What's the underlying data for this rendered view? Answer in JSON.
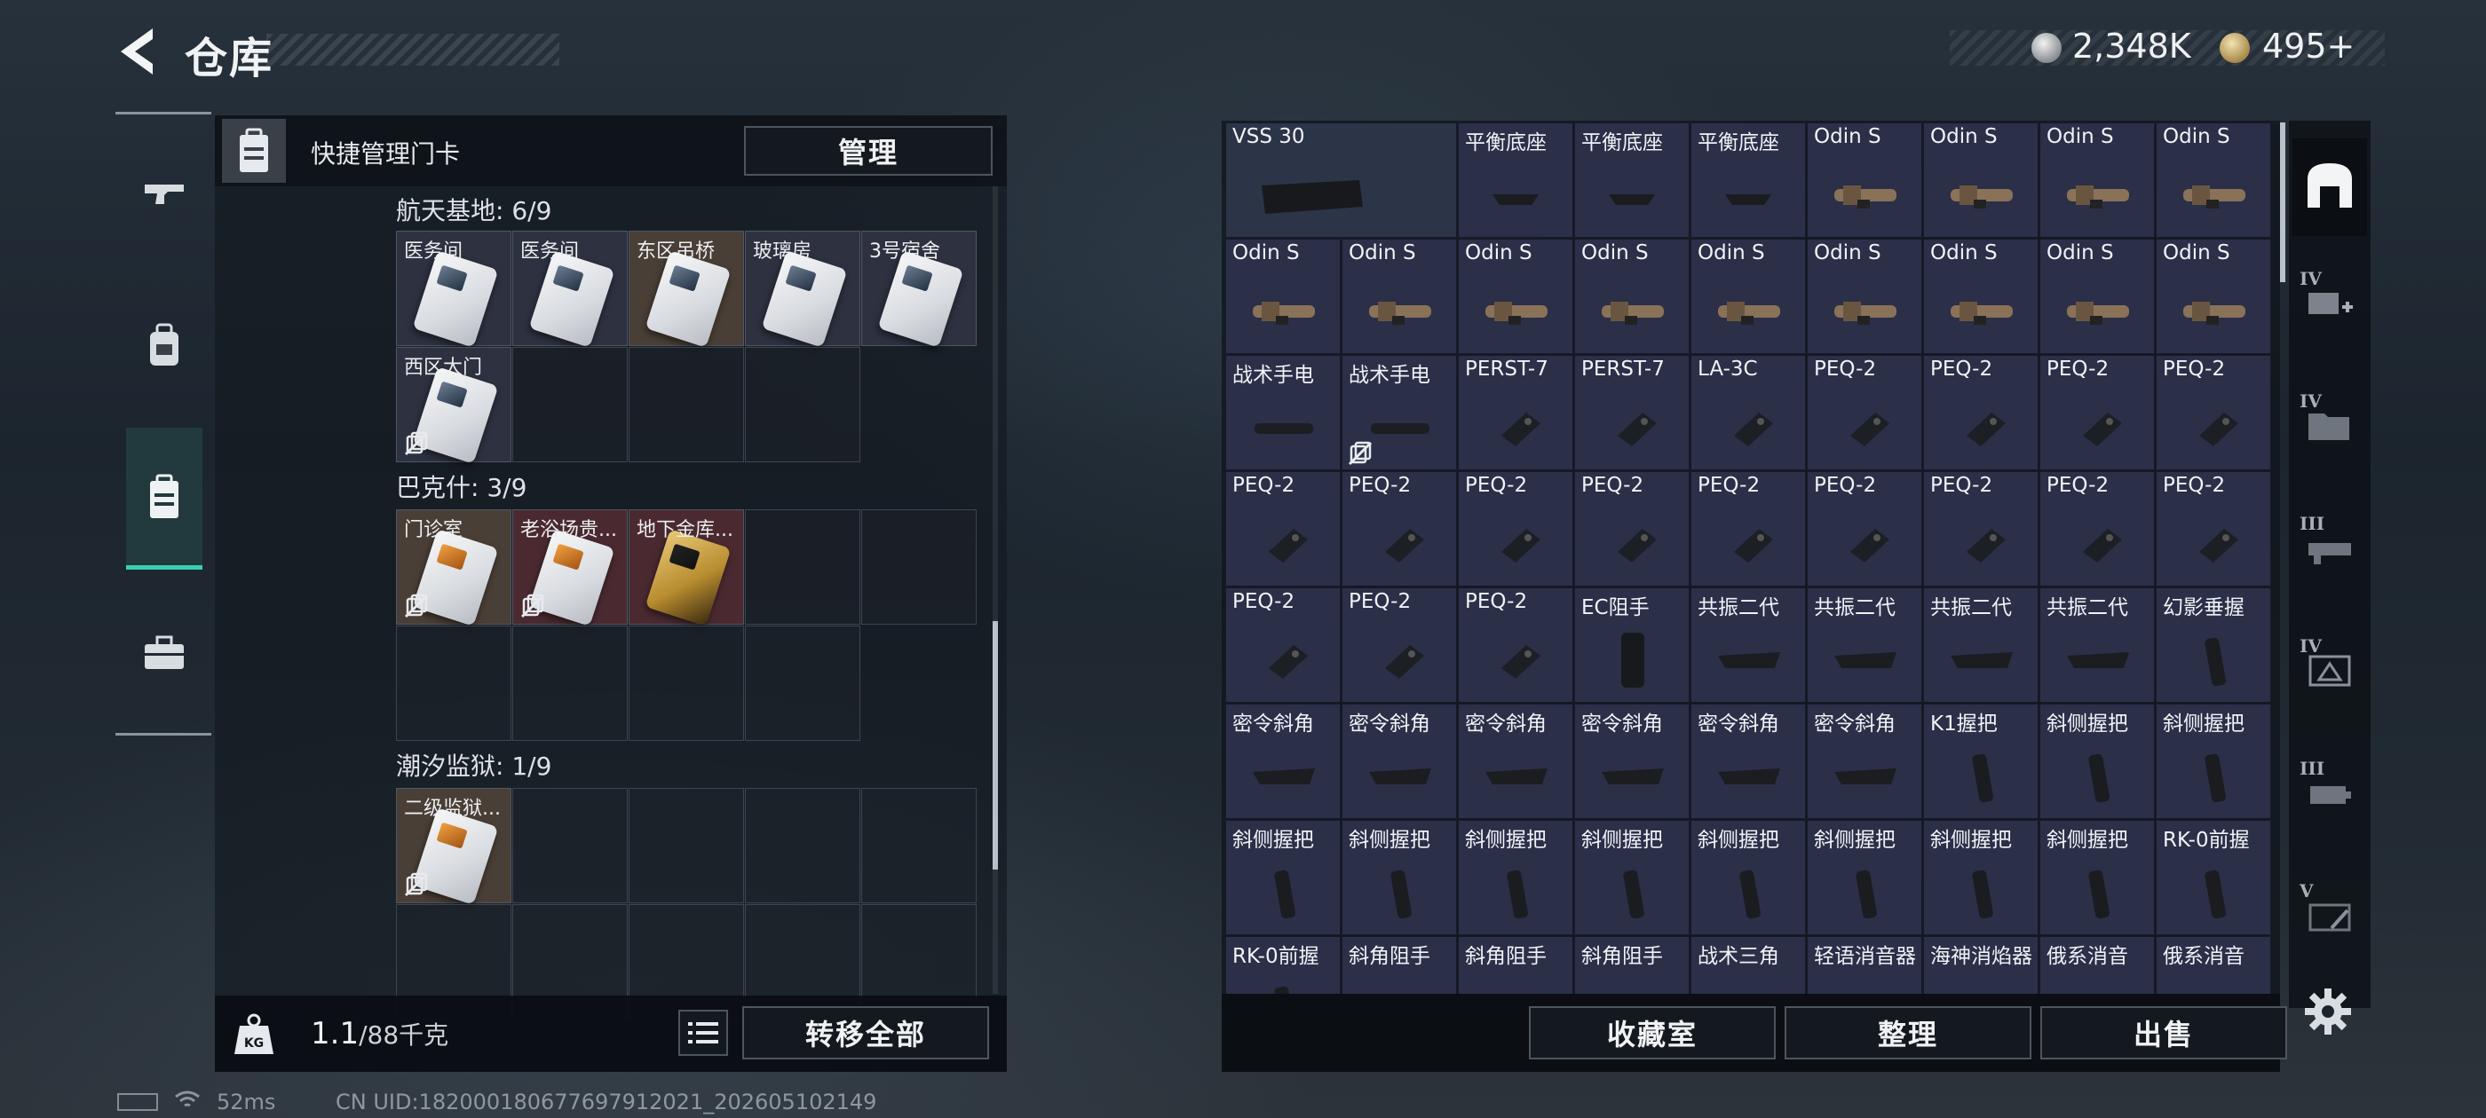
{
  "header": {
    "title": "仓库"
  },
  "currency": {
    "silver": "2,348K",
    "gold": "495+"
  },
  "left_rail": {
    "items": [
      {
        "name": "weapon",
        "icon": "pistol-icon"
      },
      {
        "name": "armor",
        "icon": "backpack-icon"
      },
      {
        "name": "keycard",
        "icon": "keycard-holder-icon",
        "active": true
      },
      {
        "name": "toolbox",
        "icon": "toolbox-icon"
      }
    ]
  },
  "keycard_panel": {
    "title": "快捷管理门卡",
    "manage_label": "管理",
    "sections": [
      {
        "label": "航天基地: 6/9",
        "cards": [
          {
            "name": "医务间",
            "style": "white",
            "locked": false,
            "bg": "#2d3140"
          },
          {
            "name": "医务间",
            "style": "white",
            "locked": false,
            "bg": "#2d3140"
          },
          {
            "name": "东区吊桥",
            "style": "white",
            "locked": false,
            "bg": "#4a3f36"
          },
          {
            "name": "玻璃房",
            "style": "white",
            "locked": false,
            "bg": "#2d3140"
          },
          {
            "name": "3号宿舍",
            "style": "white",
            "locked": false,
            "bg": "#2d3140"
          },
          {
            "name": "西区大门",
            "style": "white",
            "locked": true,
            "bg": "#2d3140"
          }
        ]
      },
      {
        "label": "巴克什: 3/9",
        "cards": [
          {
            "name": "门诊室",
            "style": "orange",
            "locked": true,
            "bg": "#4a3f36"
          },
          {
            "name": "老浴场贵...",
            "style": "orange",
            "locked": true,
            "bg": "#4a2a30"
          },
          {
            "name": "地下金库...",
            "style": "gold",
            "locked": false,
            "bg": "#4a2a30"
          }
        ]
      },
      {
        "label": "潮汐监狱: 1/9",
        "cards": [
          {
            "name": "二级监狱...",
            "style": "orange",
            "locked": true,
            "bg": "#4a3f36"
          }
        ]
      }
    ],
    "weight": {
      "value": "1.1",
      "max": "/88千克"
    },
    "transfer_label": "转移全部"
  },
  "inventory": {
    "rows": [
      [
        "VSS 30",
        "平衡底座",
        "平衡底座",
        "平衡底座",
        "Odin S",
        "Odin S",
        "Odin S",
        "Odin S"
      ],
      [
        "Odin S",
        "Odin S",
        "Odin S",
        "Odin S",
        "Odin S",
        "Odin S",
        "Odin S",
        "Odin S",
        "Odin S"
      ],
      [
        "战术手电",
        "战术手电",
        "PERST-7",
        "PERST-7",
        "LA-3C",
        "PEQ-2",
        "PEQ-2",
        "PEQ-2",
        "PEQ-2"
      ],
      [
        "PEQ-2",
        "PEQ-2",
        "PEQ-2",
        "PEQ-2",
        "PEQ-2",
        "PEQ-2",
        "PEQ-2",
        "PEQ-2",
        "PEQ-2"
      ],
      [
        "PEQ-2",
        "PEQ-2",
        "PEQ-2",
        "EC阻手",
        "共振二代",
        "共振二代",
        "共振二代",
        "共振二代",
        "幻影垂握"
      ],
      [
        "密令斜角",
        "密令斜角",
        "密令斜角",
        "密令斜角",
        "密令斜角",
        "密令斜角",
        "K1握把",
        "斜侧握把",
        "斜侧握把"
      ],
      [
        "斜侧握把",
        "斜侧握把",
        "斜侧握把",
        "斜侧握把",
        "斜侧握把",
        "斜侧握把",
        "斜侧握把",
        "斜侧握把",
        "RK-0前握"
      ],
      [
        "RK-0前握",
        "斜角阻手",
        "斜角阻手",
        "斜角阻手",
        "战术三角",
        "轻语消音器",
        "海神消焰器",
        "俄系消音",
        "俄系消音"
      ]
    ],
    "locked_cells": [
      [
        2,
        1
      ]
    ],
    "collection_label": "收藏室",
    "organize_label": "整理",
    "sell_label": "出售"
  },
  "right_rail": {
    "items": [
      {
        "name": "stash-home",
        "icon": "stash-arch-icon",
        "active": true,
        "tier": ""
      },
      {
        "name": "tier-iv-plus",
        "icon": "add-stash-icon",
        "tier": "IV"
      },
      {
        "name": "tier-iv-folder",
        "icon": "folder-stash-icon",
        "tier": "IV"
      },
      {
        "name": "tier-iii-rail",
        "icon": "rail-stash-icon",
        "tier": "III"
      },
      {
        "name": "tier-iv-triangle",
        "icon": "triangle-stash-icon",
        "tier": "IV"
      },
      {
        "name": "tier-iii-box",
        "icon": "box-stash-icon",
        "tier": "III"
      },
      {
        "name": "tier-v-tools",
        "icon": "tools-stash-icon",
        "tier": "V"
      }
    ]
  },
  "status_bar": {
    "ping": "52ms",
    "uid": "CN UID:1820001806776979120​21_202605102149"
  },
  "colors": {
    "accent": "#38d0b0",
    "cell_bg": "#2b2f48"
  }
}
